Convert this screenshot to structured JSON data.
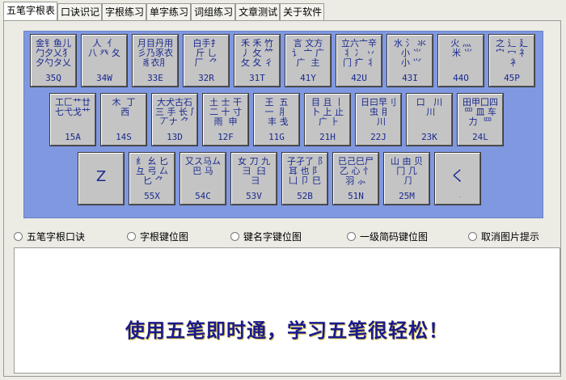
{
  "tabs": [
    "五笔字根表",
    "口诀识记",
    "字根练习",
    "单字练习",
    "词组练习",
    "文章测试",
    "关于软件"
  ],
  "keys": {
    "q": {
      "glyphs": "金钅鱼儿\n勹夕乂犭\n夕勺タ乂",
      "code": "35Q"
    },
    "w": {
      "glyphs": "人  亻\n八 癶 夂",
      "code": "34W"
    },
    "e": {
      "glyphs": "月目丹用\n彡乃豕衣\n豸衣⺼",
      "code": "33E"
    },
    "r": {
      "glyphs": "白手扌\n斤 乚\n厂  ⺈",
      "code": "32R"
    },
    "t": {
      "glyphs": "禾 禾 竹\n丿 攵 ⺮\n攵 夂 彳",
      "code": "31T"
    },
    "y": {
      "glyphs": "言 文方\n讠 亠 广\n广  主",
      "code": "41Y"
    },
    "u": {
      "glyphs": "立六亠辛\n丬 冫 丷\n门 疒 丬",
      "code": "42U"
    },
    "i": {
      "glyphs": "水 氵 氺\n 小 ⺌\n 小 ⺍",
      "code": "43I"
    },
    "o": {
      "glyphs": "火 灬\n 米 ⺌",
      "code": "44O"
    },
    "p": {
      "glyphs": "之 辶 廴\n宀 冖 礻\n  衤",
      "code": "45P"
    },
    "a": {
      "glyphs": "工匚艹廿\n七弋戈艹",
      "code": "15A"
    },
    "s": {
      "glyphs": "木  丁\n 西",
      "code": "14S"
    },
    "d": {
      "glyphs": "大犬古石\n三 手 长 厂\n丆ナ ⺈",
      "code": "13D"
    },
    "f": {
      "glyphs": "土 士 干\n二 十 寸\n雨  申",
      "code": "12F"
    },
    "g": {
      "glyphs": "王  五\n一  ⺼\n 丰 戋",
      "code": "11G"
    },
    "h": {
      "glyphs": "目 且 丨\n卜 上 止\n 广 ⺊",
      "code": "21H"
    },
    "j": {
      "glyphs": "日曰早刂\n 虫 ⺝\n  川",
      "code": "22J"
    },
    "k": {
      "glyphs": "口   川\n 川",
      "code": "23K"
    },
    "l": {
      "glyphs": "田甲囗四\n罒 皿 车\n力  罒",
      "code": "24L"
    },
    "z": {
      "glyphs": "Z",
      "code": ""
    },
    "x": {
      "glyphs": "纟 幺 匕\n彑 弓 厶\n 匕 ⺈",
      "code": "55X"
    },
    "c": {
      "glyphs": "又ス马ム\n巴 马",
      "code": "54C"
    },
    "v": {
      "glyphs": "女 刀 九\n彐  臼\n ⺕",
      "code": "53V"
    },
    "b": {
      "glyphs": "子孑了⻏\n耳 也 阝\n凵 卩 巳",
      "code": "52B"
    },
    "n": {
      "glyphs": "已己巳尸\n乙 心 忄\n羽 ⺗",
      "code": "51N"
    },
    "m": {
      "glyphs": "山 由 贝\n冂 几\n ⺆",
      "code": "25M"
    },
    "comma": {
      "glyphs": "く\n ,",
      "code": ""
    }
  },
  "radios": [
    "五笔字根口诀",
    "字根键位图",
    "键名字键位图",
    "一级简码键位图",
    "取消图片提示"
  ],
  "slogan": "使用五笔即时通，学习五笔很轻松！"
}
